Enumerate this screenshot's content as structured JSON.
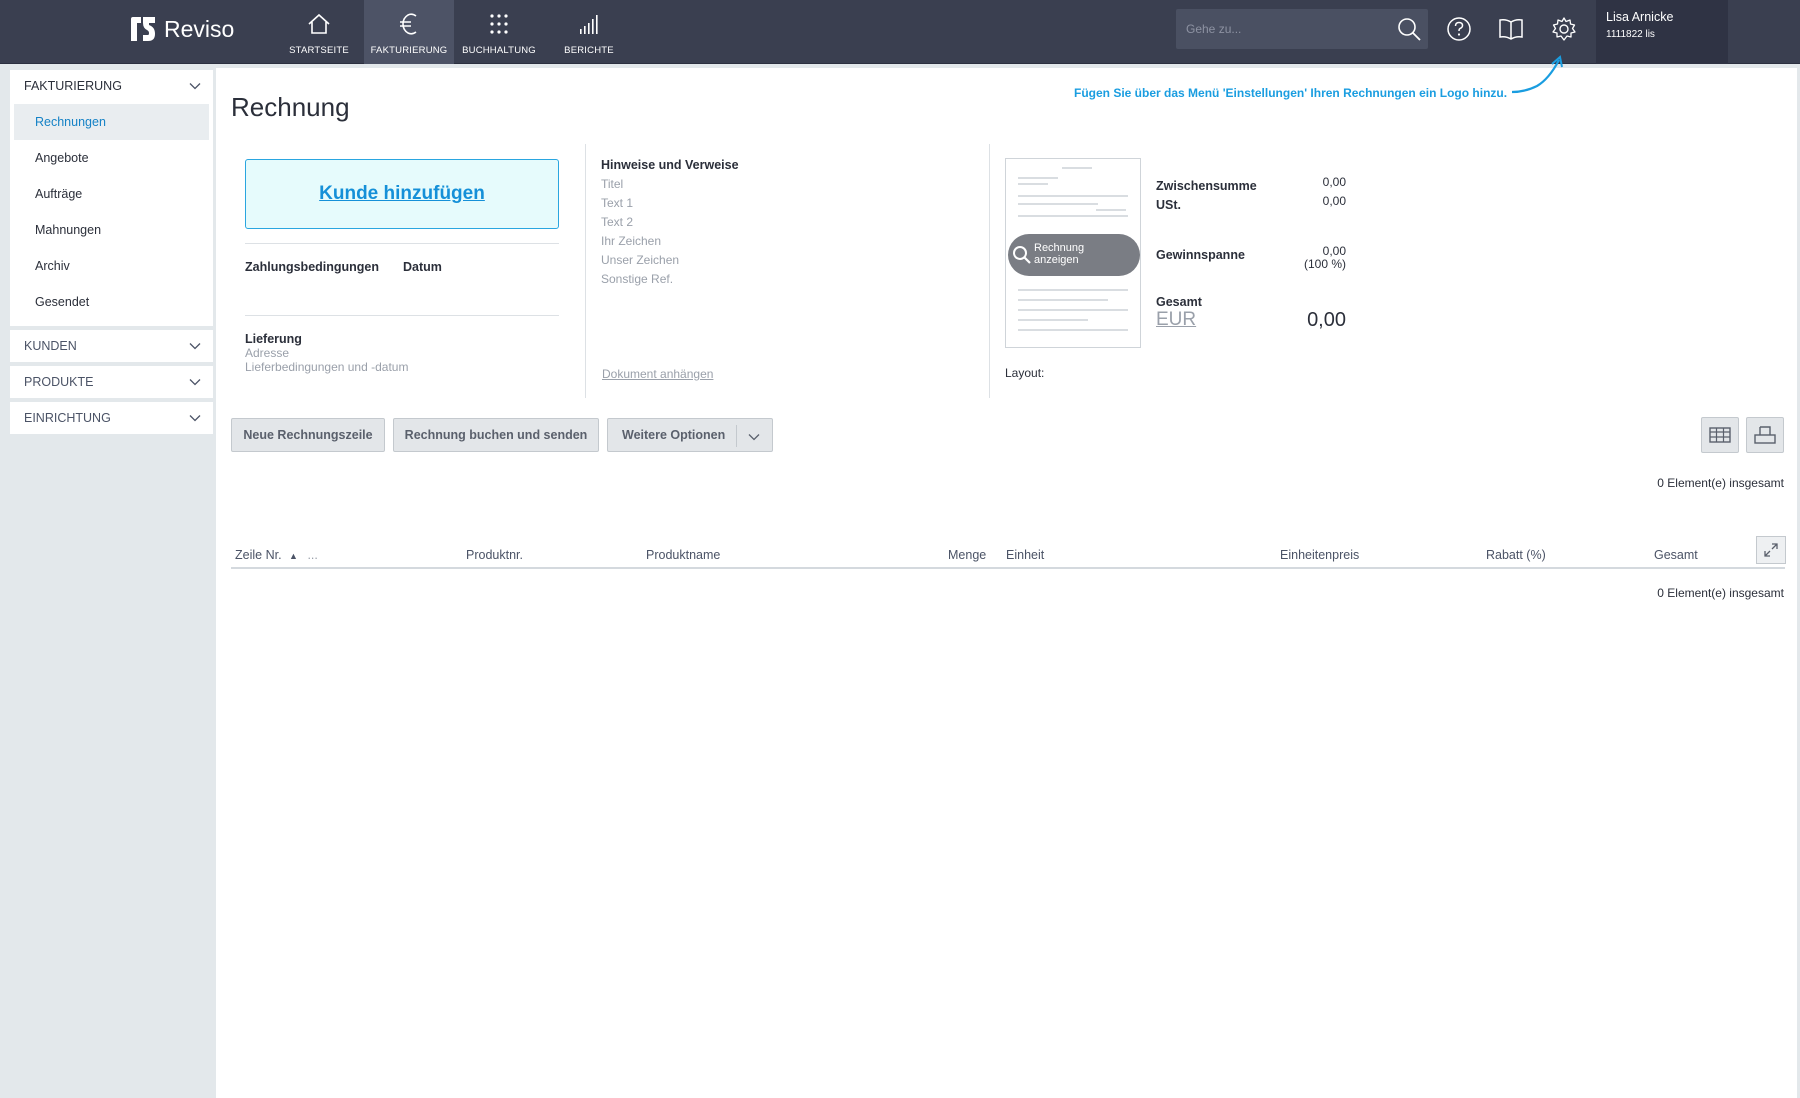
{
  "app": {
    "logo_text": "Reviso",
    "colors": {
      "topbar": "#3a3f50",
      "accent": "#1582c6",
      "hint": "#1a9de0"
    }
  },
  "nav": [
    {
      "label": "STARTSEITE",
      "icon": "home-icon"
    },
    {
      "label": "FAKTURIERUNG",
      "icon": "euro-icon",
      "active": true
    },
    {
      "label": "BUCHHALTUNG",
      "icon": "grid-dots-icon"
    },
    {
      "label": "BERICHTE",
      "icon": "bar-chart-icon"
    }
  ],
  "search": {
    "placeholder": "Gehe zu..."
  },
  "user": {
    "name": "Lisa Arnicke",
    "id": "1111822 lis"
  },
  "sidebar": {
    "fakturierung": {
      "title": "FAKTURIERUNG",
      "items": [
        "Rechnungen",
        "Angebote",
        "Aufträge",
        "Mahnungen",
        "Archiv",
        "Gesendet"
      ],
      "active": "Rechnungen"
    },
    "kunden": "KUNDEN",
    "produkte": "PRODUKTE",
    "einrichtung": "EINRICHTUNG"
  },
  "page": {
    "title": "Rechnung",
    "hint": "Fügen Sie über das Menü 'Einstellungen' Ihren Rechnungen ein Logo hinzu."
  },
  "customer": {
    "add_label": "Kunde hinzufügen",
    "payment_terms_label": "Zahlungsbedingungen",
    "date_label": "Datum",
    "delivery_label": "Lieferung",
    "address_placeholder": "Adresse",
    "delivery_terms_placeholder": "Lieferbedingungen und -datum"
  },
  "notes": {
    "title": "Hinweise und Verweise",
    "fields": [
      "Titel",
      "Text 1",
      "Text 2",
      "Ihr Zeichen",
      "Unser Zeichen",
      "Sonstige Ref."
    ],
    "attach_label": "Dokument anhängen"
  },
  "preview": {
    "label_line1": "Rechnung",
    "label_line2": "anzeigen",
    "layout_label": "Layout:"
  },
  "summary": {
    "subtotal_label": "Zwischensumme",
    "subtotal_value": "0,00",
    "vat_label": "USt.",
    "vat_value": "0,00",
    "margin_label": "Gewinnspanne",
    "margin_value": "0,00",
    "margin_percent": "(100 %)",
    "total_label": "Gesamt",
    "currency": "EUR",
    "total_value": "0,00"
  },
  "actions": {
    "new_line": "Neue Rechnungszeile",
    "book_send": "Rechnung buchen und senden",
    "more_options": "Weitere Optionen"
  },
  "table": {
    "count_top": "0 Element(e) insgesamt",
    "count_bottom": "0 Element(e) insgesamt",
    "columns": {
      "line_no": "Zeile Nr.",
      "more": "...",
      "product_no": "Produktnr.",
      "product_name": "Produktname",
      "quantity": "Menge",
      "unit": "Einheit",
      "unit_price": "Einheitenpreis",
      "discount": "Rabatt (%)",
      "total": "Gesamt"
    }
  }
}
